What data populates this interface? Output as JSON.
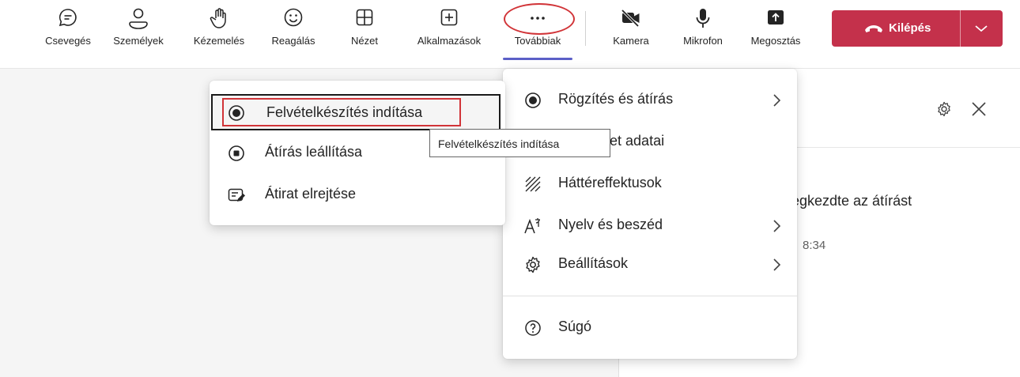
{
  "toolbar": {
    "buttons": [
      {
        "label": "Csevegés",
        "icon": "chat-icon"
      },
      {
        "label": "Személyek",
        "icon": "people-icon"
      },
      {
        "label": "Kézemelés",
        "icon": "raise-hand-icon"
      },
      {
        "label": "Reagálás",
        "icon": "smiley-icon"
      },
      {
        "label": "Nézet",
        "icon": "view-grid-icon"
      },
      {
        "label": "Alkalmazások",
        "icon": "add-app-icon"
      },
      {
        "label": "Továbbiak",
        "icon": "more-icon"
      },
      {
        "label": "Kamera",
        "icon": "camera-off-icon"
      },
      {
        "label": "Mikrofon",
        "icon": "microphone-icon"
      },
      {
        "label": "Megosztás",
        "icon": "share-icon"
      }
    ],
    "leave_label": "Kilépés",
    "leave_color": "#c4314b",
    "accent_color": "#5b5fc7",
    "highlight_color": "#d13438"
  },
  "menu": {
    "items": [
      {
        "label": "Rögzítés és átírás",
        "icon": "record-icon",
        "has_submenu": true
      },
      {
        "label": "Értekezlet adatai",
        "icon": "info-icon",
        "has_submenu": false
      },
      {
        "label": "Háttéreffektusok",
        "icon": "background-effects-icon",
        "has_submenu": false
      },
      {
        "label": "Nyelv és beszéd",
        "icon": "language-icon",
        "has_submenu": true
      },
      {
        "label": "Beállítások",
        "icon": "gear-icon",
        "has_submenu": true
      }
    ],
    "help_label": "Súgó"
  },
  "submenu": {
    "items": [
      {
        "label": "Felvételkészítés indítása",
        "icon": "record-icon"
      },
      {
        "label": "Átírás leállítása",
        "icon": "stop-icon"
      },
      {
        "label": "Átirat elrejtése",
        "icon": "transcript-icon"
      }
    ]
  },
  "tooltip": "Felvételkészítés indítása",
  "side_pane": {
    "message": "megkezdte az átírást",
    "time": "8:34"
  }
}
